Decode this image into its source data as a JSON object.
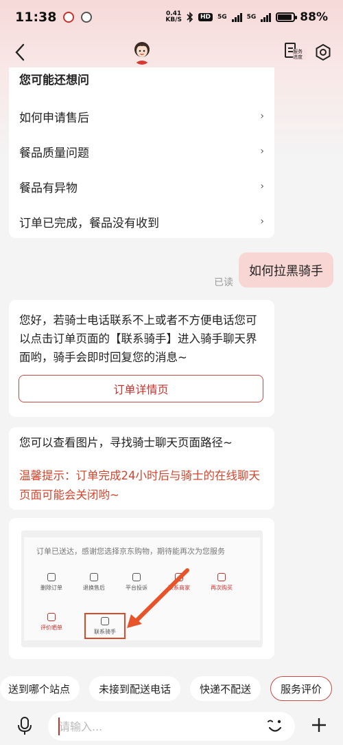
{
  "status_bar": {
    "time": "11:38",
    "net_speed_value": "0.41",
    "net_speed_unit": "KB/S",
    "hd_label": "HD",
    "signal_1": "5G",
    "signal_2": "5G",
    "battery_percent": "88%",
    "battery_level": 0.88
  },
  "nav": {
    "back_icon": "chevron-left-icon",
    "service_label": "服务进度",
    "settings_icon": "hexagon-settings-icon"
  },
  "faq": {
    "title": "您可能还想问",
    "items": [
      {
        "label": "如何申请售后",
        "chevron": "›"
      },
      {
        "label": "餐品质量问题",
        "chevron": "›"
      },
      {
        "label": "餐品有异物",
        "chevron": "›"
      },
      {
        "label": "订单已完成，餐品没有收到",
        "chevron": "›"
      }
    ]
  },
  "user_message": {
    "text": "如何拉黑骑手",
    "status": "已读"
  },
  "reply": {
    "text": "您好，若骑士电话联系不上或者不方便电话您可以点击订单页面的【联系骑手】进入骑手聊天界面哟，骑手会即时回复您的消息~",
    "button_label": "订单详情页"
  },
  "hint": {
    "text": "您可以查看图片，寻找骑士聊天页面路径~",
    "warning": "温馨提示：订单完成24小时后与骑士的在线聊天页面可能会关闭哟~"
  },
  "image_message": {
    "header": "订单已送达，感谢您选择京东购物，期待能再次为您服务",
    "buttons": [
      "删除订单",
      "退换售后",
      "平台投诉",
      "联系商家",
      "再次购买",
      "评价晒单",
      "联系骑手"
    ]
  },
  "quick_replies": [
    "送到哪个站点",
    "未接到配送电话",
    "快递不配送",
    "服务评价"
  ],
  "input": {
    "placeholder": "请输入..."
  },
  "colors": {
    "accent": "#c9302c",
    "user_bubble": "#f7d6d3",
    "warning": "#d2452e"
  }
}
